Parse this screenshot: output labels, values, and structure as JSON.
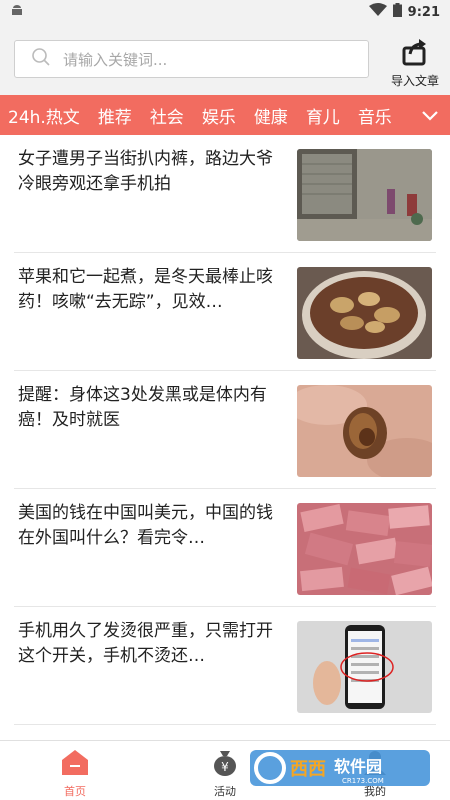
{
  "status_bar": {
    "time": "9:21"
  },
  "search": {
    "placeholder": "请输入关键词..."
  },
  "import_button": {
    "label": "导入文章"
  },
  "tabs": [
    "24h.热文",
    "推荐",
    "社会",
    "娱乐",
    "健康",
    "育儿",
    "音乐"
  ],
  "articles": [
    {
      "title": "女子遭男子当街扒内裤，路边大爷冷眼旁观还拿手机拍",
      "image": "street-scene"
    },
    {
      "title": "苹果和它一起煮，是冬天最棒止咳药！咳嗽“去无踪”，见效…",
      "image": "apple-soup-bowl"
    },
    {
      "title": "提醒：身体这3处发黑或是体内有癌！及时就医",
      "image": "skin-mole"
    },
    {
      "title": "美国的钱在中国叫美元，中国的钱在外国叫什么？看完令…",
      "image": "banknote-bundles"
    },
    {
      "title": "手机用久了发烫很严重，只需打开这个开关，手机不烫还…",
      "image": "phone-settings"
    }
  ],
  "bottom_nav": {
    "home": "首页",
    "activity": "活动",
    "mine": "我的"
  },
  "watermark": {
    "brand": "西西",
    "text": "软件园",
    "domain": "CR173.COM"
  },
  "colors": {
    "accent": "#f26c60",
    "header_bg": "#f2f2f2"
  }
}
